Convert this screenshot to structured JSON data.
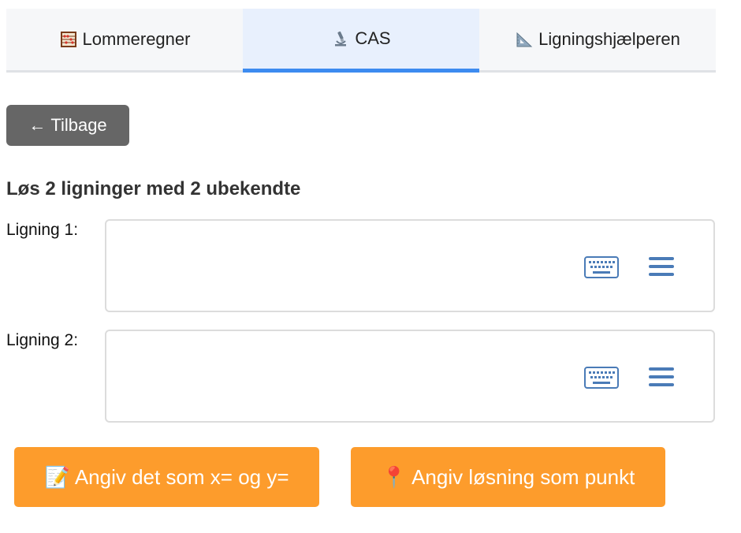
{
  "tabs": [
    {
      "label": "Lommeregner",
      "icon": "abacus-icon"
    },
    {
      "label": "CAS",
      "icon": "microscope-icon",
      "active": true
    },
    {
      "label": "Ligningshjælperen",
      "icon": "triangle-ruler-icon"
    }
  ],
  "back_button": {
    "arrow": "←",
    "label": "Tilbage"
  },
  "heading": "Løs 2 ligninger med 2 ubekendte",
  "equations": [
    {
      "label": "Ligning 1:",
      "value": ""
    },
    {
      "label": "Ligning 2:",
      "value": ""
    }
  ],
  "actions": [
    {
      "emoji": "📝",
      "label": "Angiv det som x= og y="
    },
    {
      "emoji": "📍",
      "label": "Angiv løsning som punkt"
    }
  ],
  "colors": {
    "accent_blue": "#3d8bf0",
    "action_orange": "#fd9c2c",
    "back_gray": "#666666",
    "icon_blue": "#4a7bb7"
  }
}
